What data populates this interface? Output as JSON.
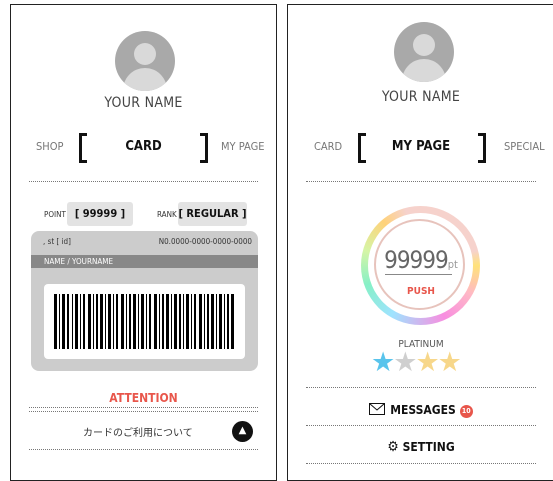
{
  "left": {
    "user_name": "YOUR NAME",
    "tabs": {
      "prev": "SHOP",
      "current": "CARD",
      "next": "MY PAGE"
    },
    "point_label": "POINT",
    "point_value": "[ 99999 ]",
    "rank_label": "RANK",
    "rank_value": "[ REGULAR ]",
    "card": {
      "code": ", st [ id]",
      "number": "N0.0000-0000-0000-0000",
      "name_label": "NAME / YOURNAME"
    },
    "attention": "ATTENTION",
    "card_usage_text": "カードのご利用について",
    "card_usage_icon": "chevron-up-icon"
  },
  "right": {
    "user_name": "YOUR NAME",
    "tabs": {
      "prev": "CARD",
      "current": "MY PAGE",
      "next": "SPECIAL"
    },
    "points": "99999",
    "points_unit": "pt",
    "push_label": "PUSH",
    "rank": "PLATINUM",
    "stars": [
      {
        "color": "#59c4ec",
        "filled": true
      },
      {
        "color": "#cfcfcf",
        "filled": false
      },
      {
        "color": "#f7d78a",
        "filled": false
      },
      {
        "color": "#f7d78a",
        "filled": false
      }
    ],
    "messages_label": "MESSAGES",
    "messages_count": "10",
    "setting_label": "SETTING"
  },
  "colors": {
    "accent": "#e8564b",
    "card_bg": "#cccccc",
    "name_bar": "#888888"
  }
}
